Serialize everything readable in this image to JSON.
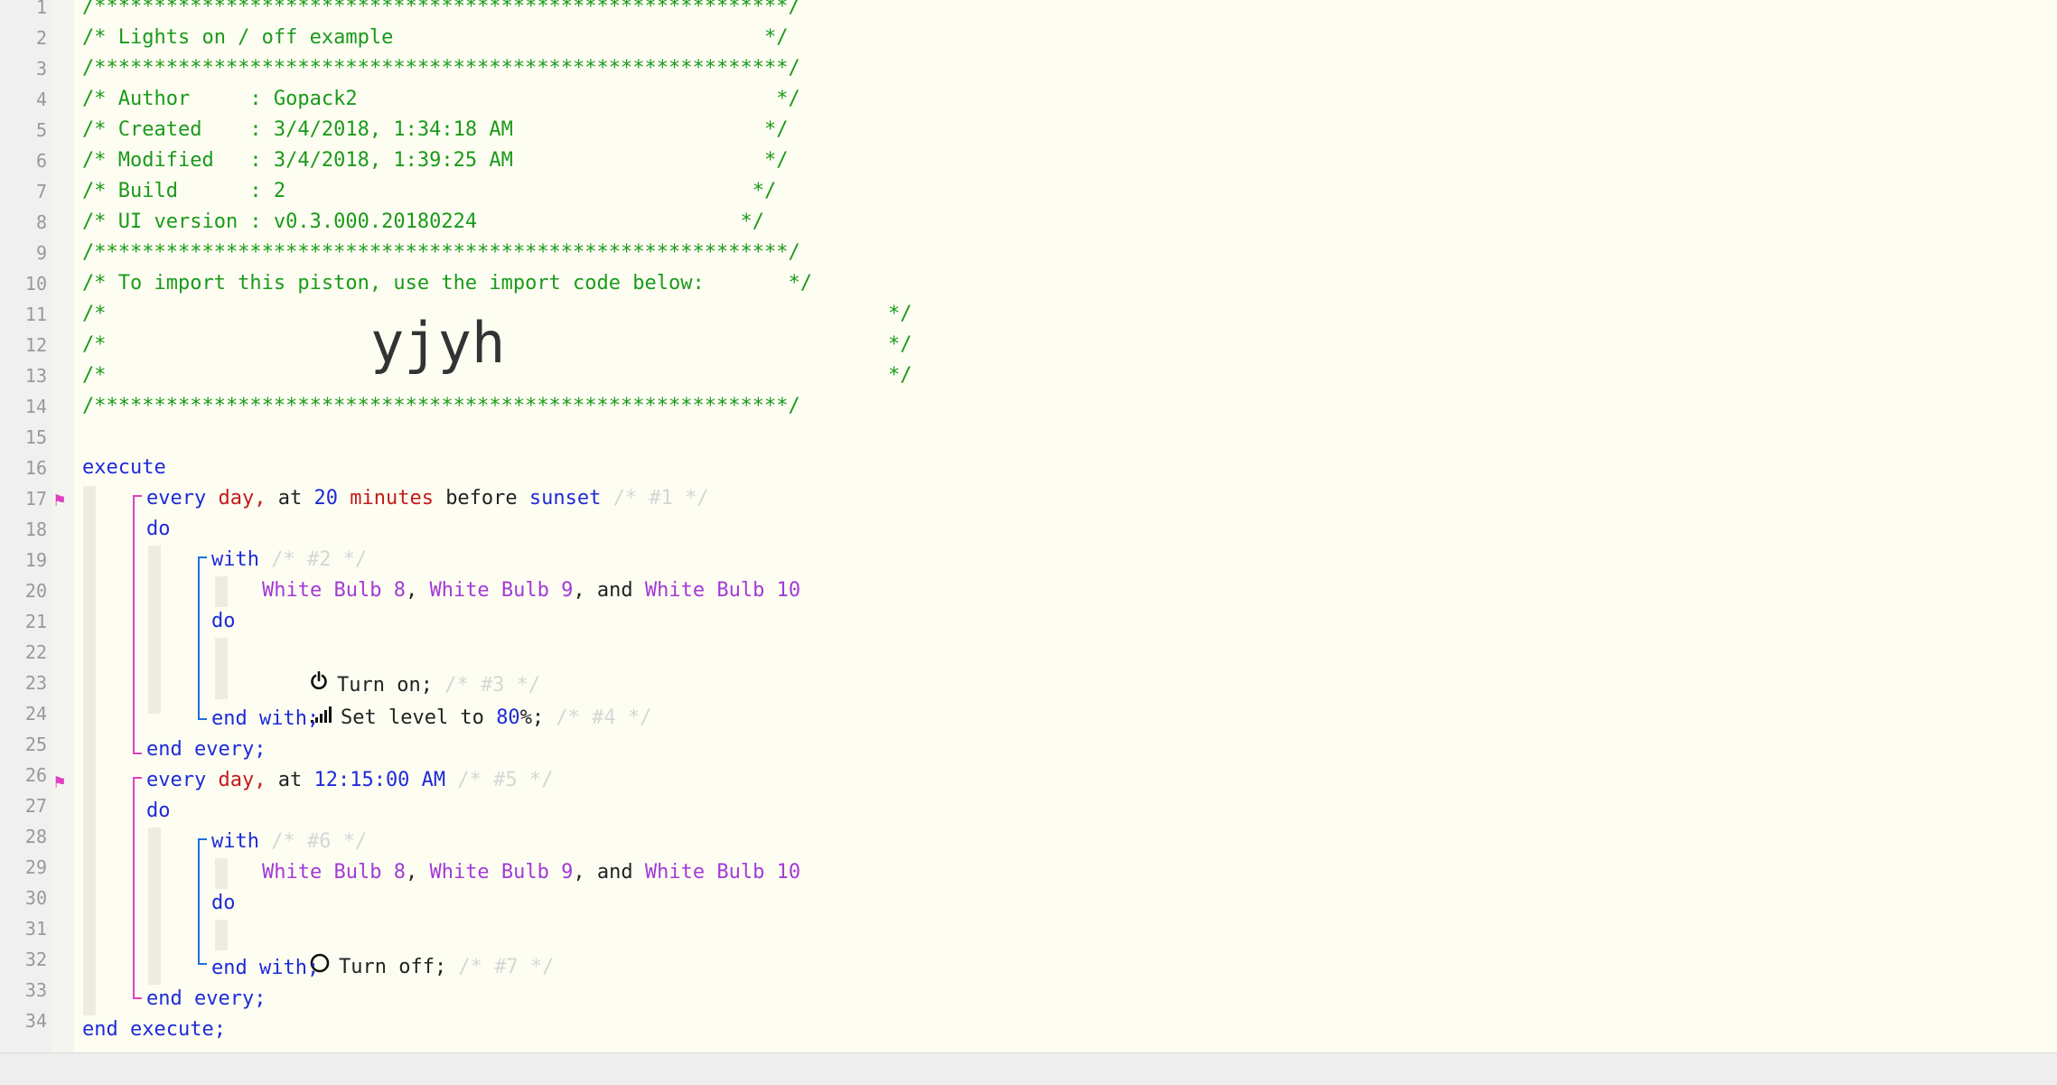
{
  "header": {
    "border": "/**********************************************************/",
    "title": "/* Lights on / off example                               */",
    "author": "/* Author     : Gopack2                                   */",
    "created": "/* Created    : 3/4/2018, 1:34:18 AM                     */",
    "modified": "/* Modified   : 3/4/2018, 1:39:25 AM                     */",
    "build": "/* Build      : 2                                       */",
    "ui_version": "/* UI version : v0.3.000.20180224                      */",
    "import_note": "/* To import this piston, use the import code below:       */",
    "blank_open": "/*",
    "blank_close": "*/",
    "import_code": "yjyh"
  },
  "code": {
    "execute": "execute",
    "end_execute": "end execute;",
    "every": "every",
    "day": "day,",
    "at": "at",
    "minutes_value": "20",
    "minutes": "minutes",
    "before": "before",
    "sunset": "sunset",
    "stmt1": "/* #1 */",
    "do": "do",
    "with": "with",
    "stmt2": "/* #2 */",
    "dev1": "White Bulb 8",
    "dev2": "White Bulb 9",
    "and": "and",
    "dev3": "White Bulb 10",
    "comma": ",",
    "turn_on": "Turn on;",
    "stmt3": "/* #3 */",
    "set_level": "Set level to",
    "level_value": "80",
    "level_unit": "%;",
    "stmt4": "/* #4 */",
    "end_with": "end with;",
    "end_every": "end every;",
    "time_value": "12:15:00 AM",
    "stmt5": "/* #5 */",
    "stmt6": "/* #6 */",
    "turn_off": "Turn off;",
    "stmt7": "/* #7 */"
  },
  "line_numbers": [
    "1",
    "2",
    "3",
    "4",
    "5",
    "6",
    "7",
    "8",
    "9",
    "10",
    "11",
    "12",
    "13",
    "14",
    "15",
    "16",
    "17",
    "18",
    "19",
    "20",
    "21",
    "22",
    "23",
    "24",
    "25",
    "26",
    "27",
    "28",
    "29",
    "30",
    "31",
    "32",
    "33",
    "34"
  ],
  "flag_icon": "flag-icon",
  "icons": {
    "power_on": "power-icon",
    "level": "signal-bars-icon",
    "power_off": "circle-icon"
  },
  "colors": {
    "comment": "#1a9a1a",
    "keyword": "#1d2bd8",
    "device": "#a23ad8",
    "value_red": "#c21a1a",
    "flag": "#e040c0"
  }
}
